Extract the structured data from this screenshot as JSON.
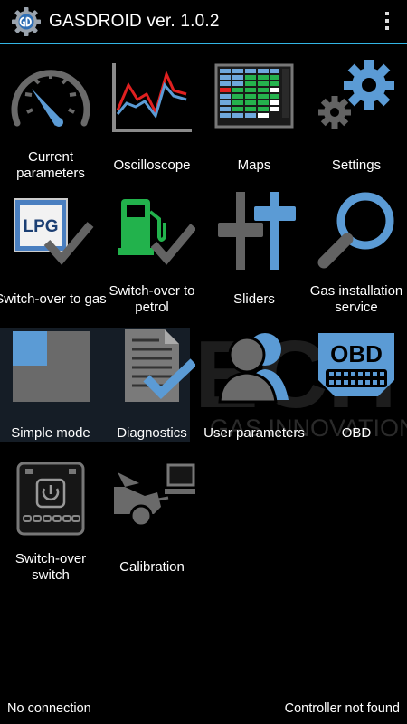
{
  "header": {
    "title": "GASDROID ver. 1.0.2",
    "app_icon": "gear-gd-logo-icon",
    "menu_icon": "overflow-menu-icon"
  },
  "watermark": {
    "brand": "ECH",
    "tagline": "GAS INNOVATIONS"
  },
  "tiles": [
    {
      "label": "Current parameters",
      "icon": "speedometer-icon"
    },
    {
      "label": "Oscilloscope",
      "icon": "oscilloscope-icon"
    },
    {
      "label": "Maps",
      "icon": "map-grid-icon"
    },
    {
      "label": "Settings",
      "icon": "gears-icon"
    },
    {
      "label": "Switch-over to gas",
      "icon": "lpg-check-icon",
      "badge": "LPG"
    },
    {
      "label": "Switch-over to petrol",
      "icon": "fuel-pump-check-icon"
    },
    {
      "label": "Sliders",
      "icon": "sliders-icon"
    },
    {
      "label": "Gas installation service",
      "icon": "magnifier-icon"
    },
    {
      "label": "Simple mode",
      "icon": "simple-mode-icon"
    },
    {
      "label": "Diagnostics",
      "icon": "diagnostics-icon"
    },
    {
      "label": "User parameters",
      "icon": "users-icon"
    },
    {
      "label": "OBD",
      "icon": "obd-connector-icon",
      "badge": "OBD"
    },
    {
      "label": "Switch-over switch",
      "icon": "switch-panel-icon"
    },
    {
      "label": "Calibration",
      "icon": "calibration-car-icon"
    }
  ],
  "status": {
    "left": "No connection",
    "right": "Controller not found"
  },
  "colors": {
    "accent": "#33b5e5",
    "icon_blue": "#5b9bd5",
    "icon_gray": "#636363",
    "icon_red": "#e02020",
    "icon_green": "#22b24c"
  }
}
